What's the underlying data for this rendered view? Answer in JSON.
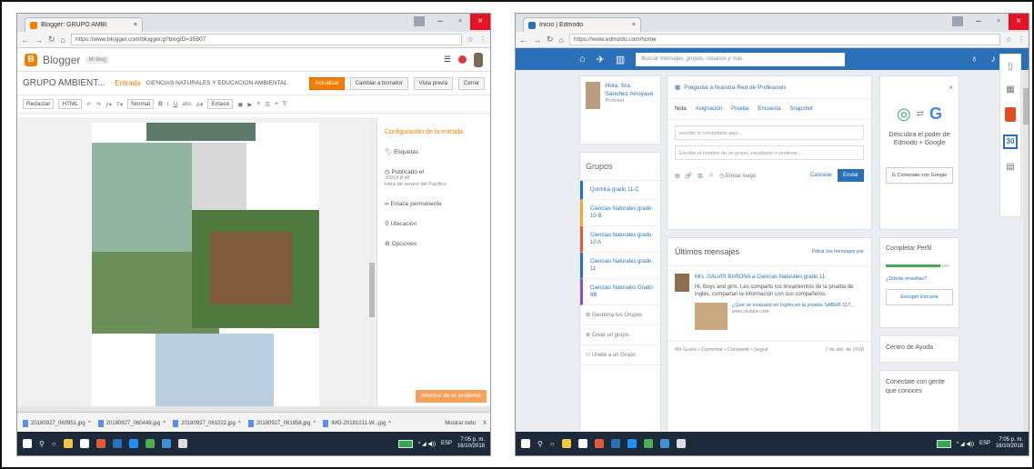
{
  "colors": {
    "blogger_orange": "#f57d00",
    "edmodo_blue": "#2a70b8",
    "close_red": "#e81123",
    "taskbar": "#1c2a3a"
  },
  "left": {
    "tab_title": "Blogger: GRUPO AMBI",
    "url": "https://www.blogger.com/blogger.g?blogID=35807",
    "app_name": "Blogger",
    "my_blogs": "Mi blog",
    "blog_title": "GRUPO AMBIENT...",
    "breadcrumb": "· Entrada",
    "post_title": "CIENCIAS NATURALES Y EDUCACIÓN AMBIENTAL",
    "buttons": {
      "publish": "Actualizar",
      "revert": "Cambiar a borrador",
      "preview": "Vista previa",
      "close": "Cerrar"
    },
    "toolbar": {
      "compose": "Redactar",
      "html": "HTML",
      "font": "Normal",
      "link": "Enlace"
    },
    "sidebar": {
      "settings": "Configuración de la entrada",
      "labels": "Etiquetas",
      "published": "Publicado el",
      "published_date": "3/9/18 8:48",
      "published_tz": "Hora de verano del Pacífico",
      "permalink": "Enlace permanente",
      "location": "Ubicación",
      "options": "Opciones"
    },
    "publish_popup": "Informar de un problema",
    "downloads": [
      "20180927_060951.jpg",
      "20180927_060449.jpg",
      "20180927_061022.jpg",
      "20180927_061858.jpg",
      "IMG-20181011-W...jpg"
    ],
    "show_all": "Mostrar todo",
    "tray": {
      "lang": "ESP",
      "time": "7:05 p. m.",
      "date": "16/10/2018"
    }
  },
  "right": {
    "tab_title": "Inicio | Edmodo",
    "url": "https://www.edmodo.com/home",
    "search_placeholder": "Buscar mensajes, grupos, usuarios y mas",
    "profile": {
      "name": "Hola, Sra. Sánchez Arroyave",
      "role": "Profesor"
    },
    "groups_title": "Grupos",
    "groups": [
      {
        "name": "Química grado 11-C",
        "color": "#2a70b8"
      },
      {
        "name": "Ciencias Naturales grado 10 B",
        "color": "#f2a93b"
      },
      {
        "name": "Ciencias Naturales grado 10 A",
        "color": "#e05a3a"
      },
      {
        "name": "Ciencias Naturales grado 11",
        "color": "#2a70b8"
      },
      {
        "name": "Ciencias Naturales Grado 8B",
        "color": "#8a4fb8"
      }
    ],
    "group_options": [
      "Gestiona tus Grupos",
      "Crear un grupo",
      "Unete a un Grupo"
    ],
    "composer": {
      "header": "Pregunta a Nuestra Red de Profesores",
      "tabs": [
        "Nota",
        "Asignación",
        "Prueba",
        "Encuesta",
        "Snapshot"
      ],
      "body_placeholder": "escribe tu comentario aquí...",
      "to_placeholder": "Escribe el nombre de un grupo, estudiante o profesor...",
      "schedule": "Enviar luego",
      "cancel": "Cancelar",
      "send": "Enviar"
    },
    "feed": {
      "title": "Últimos mensajes",
      "filter": "Filtrar los mensajes por",
      "author": "Mrs. GALVIS BARONA a Ciencias Naturales grado 11",
      "text": "Hi. Boys and girls. Les comparto los lineamientos de la prueba de inglés, compartan la información con sus compañeros.",
      "link_title": "¿Qué se evaluará en Inglés en la prueba SABER 11?...",
      "link_source": "www.youtube.com",
      "meta": "Me Gusta • Comentar • Compartir • Seguir",
      "date": "7 de abr. de 2018",
      "reply_placeholder": "Escribe una respuesta..."
    },
    "promo": {
      "title": "Descubra el poder de Edmodo + Google",
      "button": "Conectate con Google"
    },
    "profile_progress": {
      "title": "Completar Perfil",
      "question": "¿Dónde enseñas?",
      "button": "Escoger Escuela",
      "progress": 0.85
    },
    "help": "Centro de Ayuda",
    "connect": "Conéctate con gente que conoces",
    "calendar_day": "30",
    "tray": {
      "lang": "ESP",
      "time": "7:05 p. m.",
      "date": "16/10/2018"
    }
  }
}
